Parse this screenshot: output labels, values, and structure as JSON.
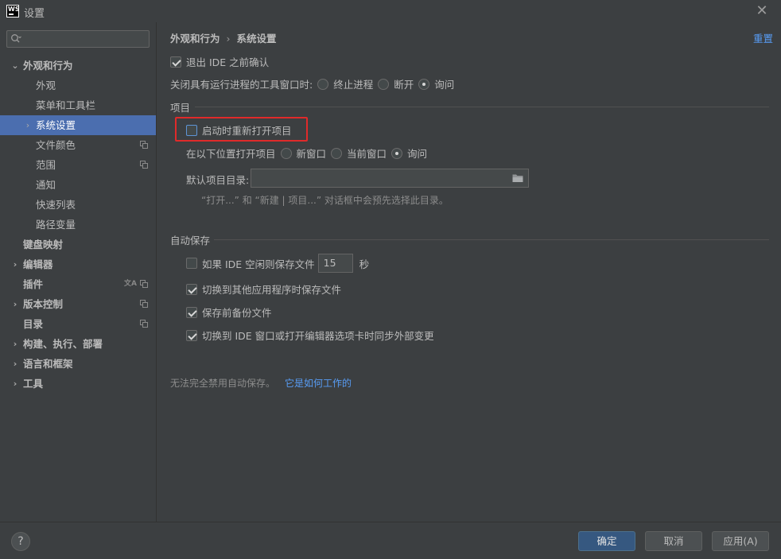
{
  "window": {
    "title": "设置",
    "logo_text": "WS"
  },
  "search": {
    "placeholder": ""
  },
  "sidebar": {
    "items": [
      {
        "label": "外观和行为",
        "level": 0,
        "expanded": true,
        "bold": true
      },
      {
        "label": "外观",
        "level": 1
      },
      {
        "label": "菜单和工具栏",
        "level": 1
      },
      {
        "label": "系统设置",
        "level": 1,
        "selected": true,
        "collapsed": true
      },
      {
        "label": "文件颜色",
        "level": 1,
        "copy_icon": true
      },
      {
        "label": "范围",
        "level": 1,
        "copy_icon": true
      },
      {
        "label": "通知",
        "level": 1
      },
      {
        "label": "快速列表",
        "level": 1
      },
      {
        "label": "路径变量",
        "level": 1
      },
      {
        "label": "键盘映射",
        "level": 0,
        "bold": true
      },
      {
        "label": "编辑器",
        "level": 0,
        "bold": true,
        "collapsed": true
      },
      {
        "label": "插件",
        "level": 0,
        "bold": true,
        "translate_icon": true,
        "copy_icon": true
      },
      {
        "label": "版本控制",
        "level": 0,
        "bold": true,
        "collapsed": true,
        "copy_icon": true
      },
      {
        "label": "目录",
        "level": 0,
        "bold": true,
        "copy_icon": true
      },
      {
        "label": "构建、执行、部署",
        "level": 0,
        "bold": true,
        "collapsed": true
      },
      {
        "label": "语言和框架",
        "level": 0,
        "bold": true,
        "collapsed": true
      },
      {
        "label": "工具",
        "level": 0,
        "bold": true,
        "collapsed": true
      }
    ]
  },
  "breadcrumb": {
    "parent": "外观和行为",
    "current": "系统设置"
  },
  "reset_label": "重置",
  "general": {
    "confirm_exit_label": "退出 IDE 之前确认",
    "confirm_exit_checked": true,
    "close_running_label": "关闭具有运行进程的工具窗口时:",
    "close_running_options": [
      "终止进程",
      "断开",
      "询问"
    ],
    "close_running_selected": "询问"
  },
  "project": {
    "section_title": "项目",
    "reopen_label": "启动时重新打开项目",
    "reopen_checked": false,
    "open_location_label": "在以下位置打开项目",
    "open_location_options": [
      "新窗口",
      "当前窗口",
      "询问"
    ],
    "open_location_selected": "询问",
    "default_dir_label": "默认项目目录:",
    "default_dir_value": "",
    "hint": "“打开...” 和 “新建 | 项目...” 对话框中会预先选择此目录。"
  },
  "autosave": {
    "section_title": "自动保存",
    "idle_label": "如果 IDE 空闲则保存文件",
    "idle_checked": false,
    "idle_seconds": "15",
    "idle_unit": "秒",
    "switch_app_label": "切换到其他应用程序时保存文件",
    "switch_app_checked": true,
    "backup_label": "保存前备份文件",
    "backup_checked": true,
    "sync_label": "切换到 IDE 窗口或打开编辑器选项卡时同步外部变更",
    "sync_checked": true,
    "note": "无法完全禁用自动保存。",
    "note_link": "它是如何工作的"
  },
  "footer": {
    "help": "?",
    "ok": "确定",
    "cancel": "取消",
    "apply": "应用(A)"
  },
  "colors": {
    "background": "#3c3f41",
    "selection": "#4b6eaf",
    "link": "#589df6",
    "highlight_box": "#e02a2a",
    "primary_button": "#365880"
  }
}
